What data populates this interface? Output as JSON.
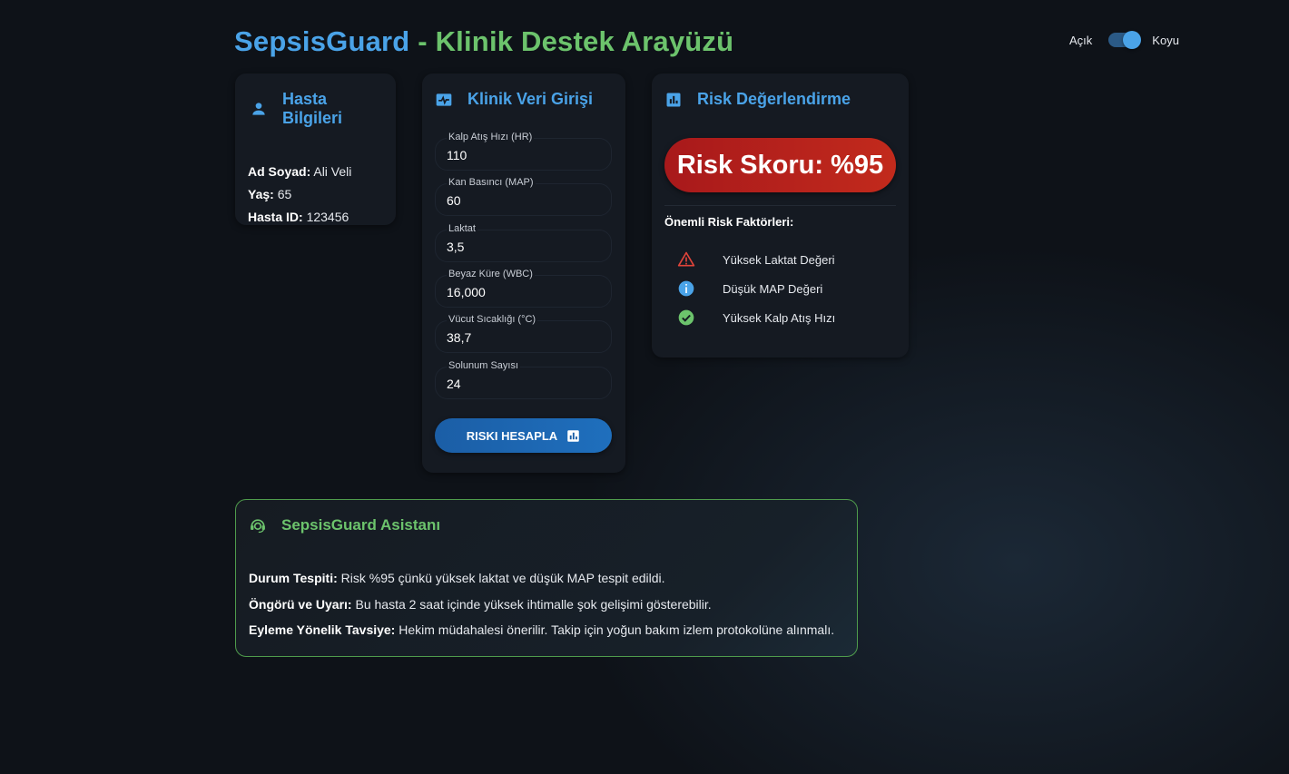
{
  "header": {
    "brand": "SepsisGuard",
    "separator": " - ",
    "subtitle": "Klinik Destek Arayüzü"
  },
  "theme": {
    "light_label": "Açık",
    "dark_label": "Koyu",
    "dark_mode_on": true
  },
  "patient": {
    "title": "Hasta Bilgileri",
    "name_label": "Ad Soyad:",
    "name": "Ali Veli",
    "age_label": "Yaş:",
    "age": "65",
    "id_label": "Hasta ID:",
    "id": "123456"
  },
  "clinical": {
    "title": "Klinik Veri Girişi",
    "fields": [
      {
        "label": "Kalp Atış Hızı (HR)",
        "value": "110"
      },
      {
        "label": "Kan Basıncı (MAP)",
        "value": "60"
      },
      {
        "label": "Laktat",
        "value": "3,5"
      },
      {
        "label": "Beyaz Küre (WBC)",
        "value": "16,000"
      },
      {
        "label": "Vücut Sıcaklığı (°C)",
        "value": "38,7"
      },
      {
        "label": "Solunum Sayısı",
        "value": "24"
      }
    ],
    "button_label": "RISKI HESAPLA"
  },
  "risk": {
    "title": "Risk Değerlendirme",
    "score_text": "Risk Skoru: %95",
    "factors_title": "Önemli Risk Faktörleri:",
    "factors": [
      {
        "icon": "warning-icon",
        "label": "Yüksek Laktat Değeri",
        "color": "#e0443a"
      },
      {
        "icon": "info-icon",
        "label": "Düşük MAP Değeri",
        "color": "#4aa3e8"
      },
      {
        "icon": "check-circle-icon",
        "label": "Yüksek Kalp Atış Hızı",
        "color": "#6cc36c"
      }
    ]
  },
  "assistant": {
    "title": "SepsisGuard Asistanı",
    "lines": [
      {
        "label": "Durum Tespiti:",
        "text": "Risk %95 çünkü yüksek laktat ve düşük MAP tespit edildi."
      },
      {
        "label": "Öngörü ve Uyarı:",
        "text": "Bu hasta 2 saat içinde yüksek ihtimalle şok gelişimi gösterebilir."
      },
      {
        "label": "Eyleme Yönelik Tavsiye:",
        "text": "Hekim müdahalesi önerilir. Takip için yoğun bakım izlem protokolüne alınmalı."
      }
    ]
  },
  "colors": {
    "primary": "#4aa3e8",
    "accent_green": "#6cc36c",
    "risk_red": "#b8201c",
    "background": "#0e1218",
    "card": "#151a22"
  }
}
